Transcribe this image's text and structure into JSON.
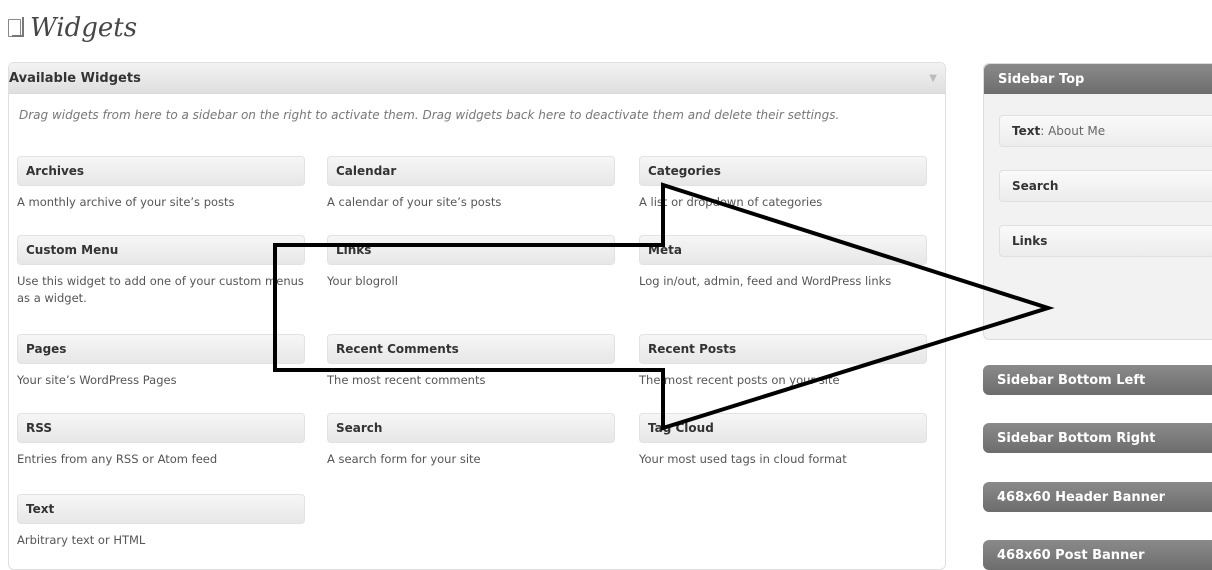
{
  "page": {
    "title": "Widgets"
  },
  "available": {
    "title": "Available Widgets",
    "toggle": "▼",
    "description": "Drag widgets from here to a sidebar on the right to activate them. Drag widgets back here to deactivate them and delete their settings.",
    "widgets": [
      {
        "title": "Archives",
        "desc": "A monthly archive of your site’s posts"
      },
      {
        "title": "Calendar",
        "desc": "A calendar of your site’s posts"
      },
      {
        "title": "Categories",
        "desc": "A list or dropdown of categories"
      },
      {
        "title": "Custom Menu",
        "desc": "Use this widget to add one of your custom menus as a widget."
      },
      {
        "title": "Links",
        "desc": "Your blogroll"
      },
      {
        "title": "Meta",
        "desc": "Log in/out, admin, feed and WordPress links"
      },
      {
        "title": "Pages",
        "desc": "Your site’s WordPress Pages"
      },
      {
        "title": "Recent Comments",
        "desc": "The most recent comments"
      },
      {
        "title": "Recent Posts",
        "desc": "The most recent posts on your site"
      },
      {
        "title": "RSS",
        "desc": "Entries from any RSS or Atom feed"
      },
      {
        "title": "Search",
        "desc": "A search form for your site"
      },
      {
        "title": "Tag Cloud",
        "desc": "Your most used tags in cloud format"
      },
      {
        "title": "Text",
        "desc": "Arbitrary text or HTML"
      }
    ]
  },
  "sidebars": {
    "top": {
      "title": "Sidebar Top",
      "widgets": [
        {
          "title": "Text",
          "extra": ": About Me"
        },
        {
          "title": "Search",
          "extra": ""
        },
        {
          "title": "Links",
          "extra": ""
        }
      ]
    },
    "bottom_left": {
      "title": "Sidebar Bottom Left"
    },
    "bottom_right": {
      "title": "Sidebar Bottom Right"
    },
    "header_banner": {
      "title": "468x60 Header Banner"
    },
    "post_banner": {
      "title": "468x60 Post Banner"
    }
  }
}
